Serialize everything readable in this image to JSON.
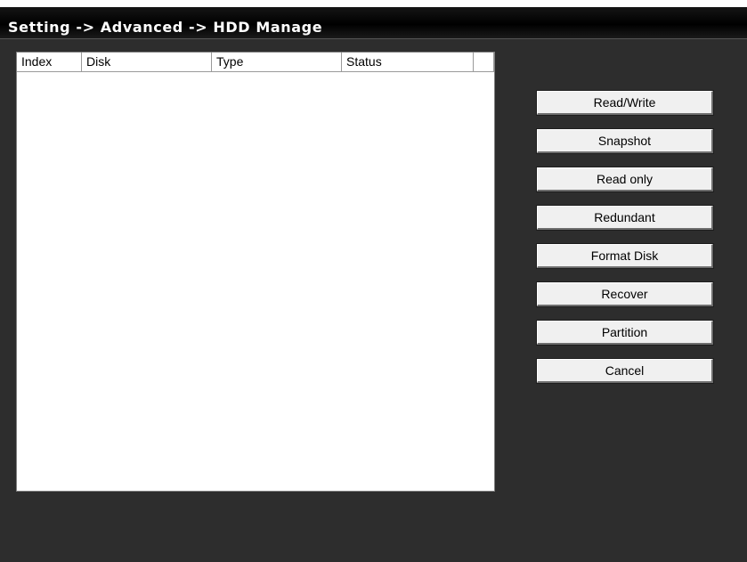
{
  "window": {
    "title": "Setting -> Advanced -> HDD Manage"
  },
  "disk_list": {
    "columns": [
      "Index",
      "Disk",
      "Type",
      "Status"
    ],
    "rows": []
  },
  "actions": {
    "read_write": "Read/Write",
    "snapshot": "Snapshot",
    "read_only": "Read only",
    "redundant": "Redundant",
    "format_disk": "Format Disk",
    "recover": "Recover",
    "partition": "Partition",
    "cancel": "Cancel"
  },
  "colors": {
    "window_background": "#2d2d2d",
    "title_bar": "#000000",
    "title_text": "#ffffff",
    "list_background": "#ffffff",
    "button_face": "#f0f0f0"
  }
}
